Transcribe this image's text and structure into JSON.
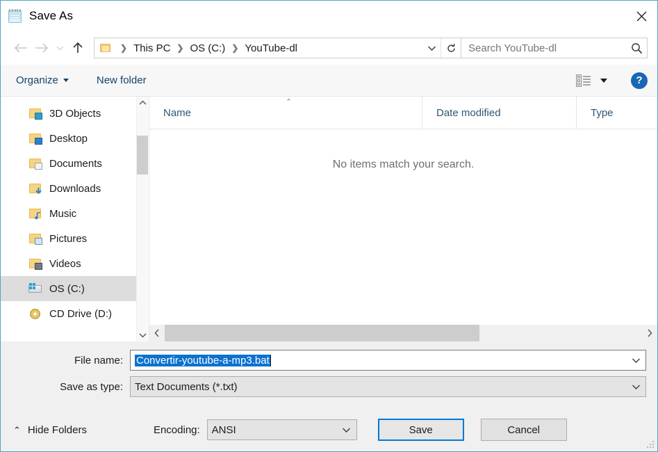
{
  "window": {
    "title": "Save As",
    "app_icon": "notepad-icon",
    "close_label": "✕"
  },
  "nav": {
    "back_icon": "arrow-left-icon",
    "forward_icon": "arrow-right-icon",
    "recent_icon": "chevron-down-icon",
    "up_icon": "arrow-up-icon",
    "breadcrumbs": [
      "This PC",
      "OS (C:)",
      "YouTube-dl"
    ],
    "separator": "❯",
    "dropdown_icon": "chevron-down-icon",
    "refresh_icon": "refresh-icon",
    "refresh_glyph": "↻"
  },
  "search": {
    "placeholder": "Search YouTube-dl",
    "icon": "search-icon"
  },
  "toolbar": {
    "organize_label": "Organize",
    "new_folder_label": "New folder",
    "view_icon": "view-layout-icon",
    "view_caret_icon": "chevron-down-icon",
    "help_label": "?",
    "help_icon": "help-icon",
    "help_color": "#1868b5"
  },
  "sidebar": {
    "items": [
      {
        "label": "3D Objects",
        "icon": "folder-3d-objects-icon",
        "selected": false
      },
      {
        "label": "Desktop",
        "icon": "folder-desktop-icon",
        "selected": false
      },
      {
        "label": "Documents",
        "icon": "folder-documents-icon",
        "selected": false
      },
      {
        "label": "Downloads",
        "icon": "folder-downloads-icon",
        "selected": false
      },
      {
        "label": "Music",
        "icon": "folder-music-icon",
        "selected": false
      },
      {
        "label": "Pictures",
        "icon": "folder-pictures-icon",
        "selected": false
      },
      {
        "label": "Videos",
        "icon": "folder-videos-icon",
        "selected": false
      },
      {
        "label": "OS (C:)",
        "icon": "drive-os-icon",
        "selected": true
      },
      {
        "label": "CD Drive (D:)",
        "icon": "cd-drive-icon",
        "selected": false
      }
    ],
    "scrollbar": {
      "up_icon": "chevron-up-icon",
      "down_icon": "chevron-down-icon"
    }
  },
  "filelist": {
    "columns": [
      "Name",
      "Date modified",
      "Type"
    ],
    "sort_caret": "⌃",
    "empty_message": "No items match your search.",
    "rows": [],
    "hscroll": {
      "left_icon": "chevron-left-icon",
      "right_icon": "chevron-right-icon"
    }
  },
  "form": {
    "filename_label": "File name:",
    "filename_value": "Convertir-youtube-a-mp3.bat",
    "filename_selected": true,
    "selection_color": "#0b72cf",
    "savetype_label": "Save as type:",
    "savetype_value": "Text Documents (*.txt)",
    "dropdown_icon": "chevron-down-icon"
  },
  "footer": {
    "hide_folders_label": "Hide Folders",
    "hide_folders_caret": "⌃",
    "encoding_label": "Encoding:",
    "encoding_value": "ANSI",
    "save_label": "Save",
    "cancel_label": "Cancel",
    "default_button": "Save",
    "focus_color": "#0078d7"
  }
}
